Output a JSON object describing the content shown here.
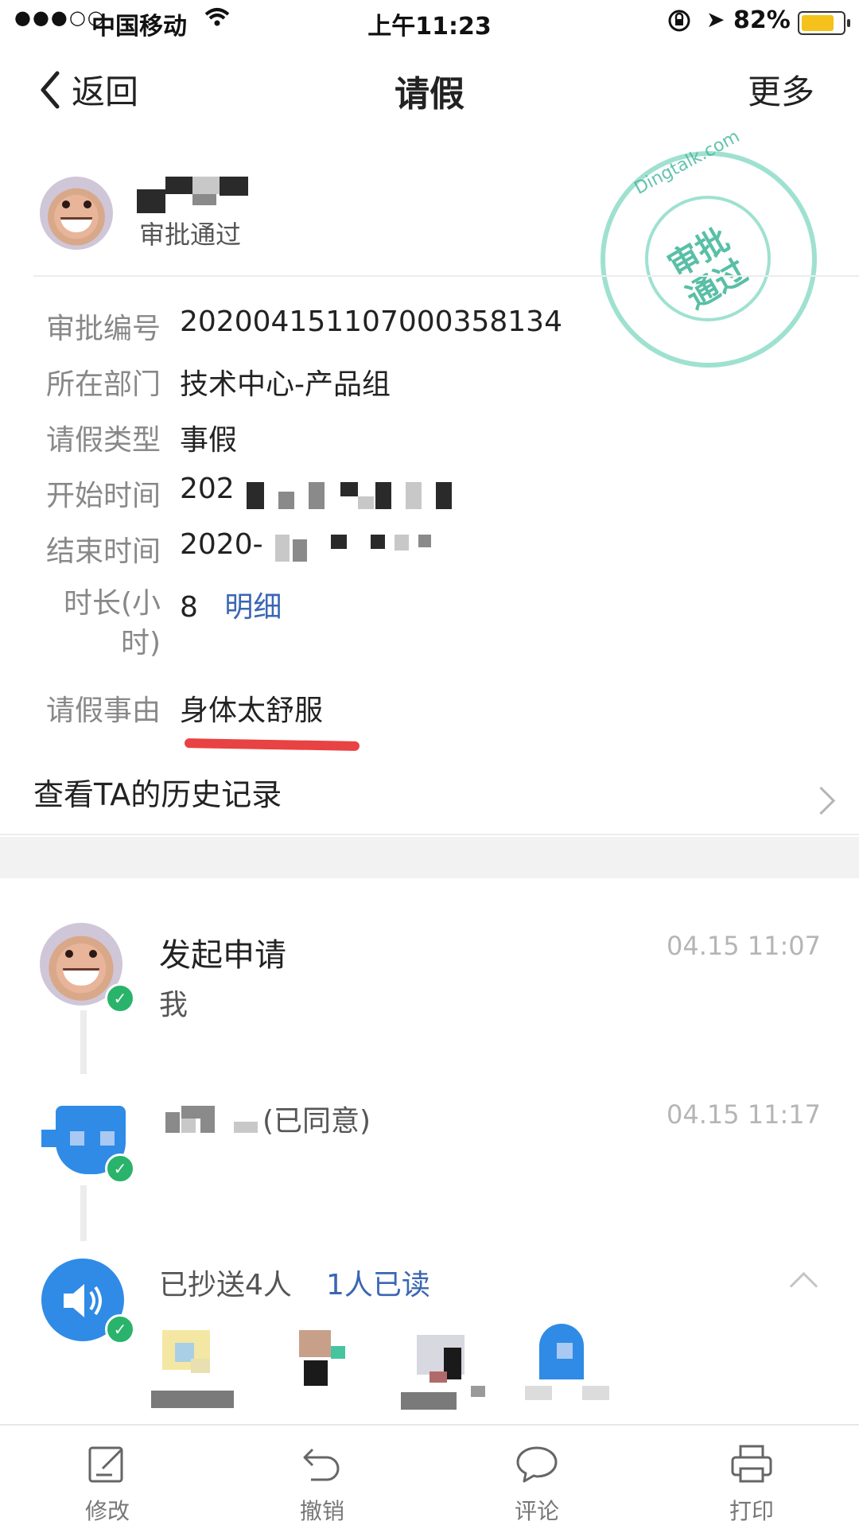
{
  "status_bar": {
    "signal": "●●●○○",
    "carrier": "中国移动",
    "time": "上午11:23",
    "battery": "82%",
    "battery_level": 0.82
  },
  "nav": {
    "back_label": "返回",
    "title": "请假",
    "more_label": "更多"
  },
  "header": {
    "approval_status": "审批通过",
    "stamp_text": "审批\n通过",
    "stamp_url": "Dingtalk.com"
  },
  "details": [
    {
      "label": "审批编号",
      "value": "202004151107000358134"
    },
    {
      "label": "所在部门",
      "value": "技术中心-产品组"
    },
    {
      "label": "请假类型",
      "value": "事假"
    },
    {
      "label": "开始时间",
      "value": "202"
    },
    {
      "label": "结束时间",
      "value": "2020-"
    },
    {
      "label": "时长(小时)",
      "value": "8",
      "link": "明细"
    },
    {
      "label": "请假事由",
      "value": "身体太舒服"
    }
  ],
  "history_link": "查看TA的历史记录",
  "timeline": {
    "step1": {
      "title": "发起申请",
      "sub": "我",
      "time": "04.15 11:07"
    },
    "step2": {
      "title": "(已同意)",
      "time": "04.15 11:17"
    },
    "step3": {
      "title": "已抄送4人",
      "read": "1人已读"
    }
  },
  "toolbar": {
    "edit": "修改",
    "revoke": "撤销",
    "comment": "评论",
    "print": "打印"
  }
}
